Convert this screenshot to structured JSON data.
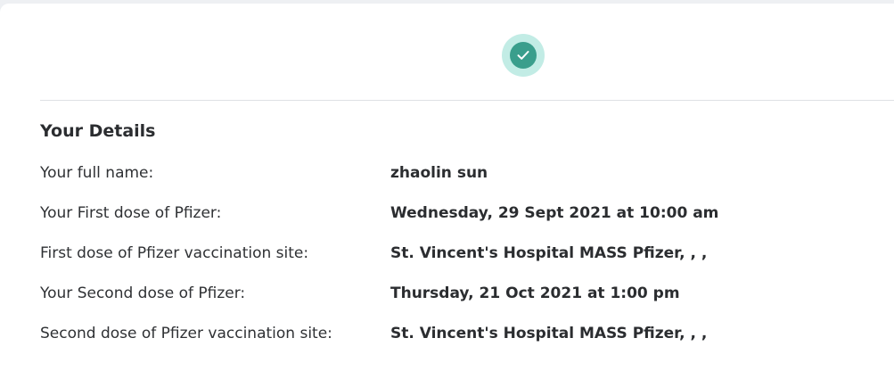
{
  "colors": {
    "accent": "#3a9e8c",
    "accent_light": "#c2ece5",
    "text": "#2b2d30"
  },
  "header": {
    "status_icon": "check-circle-icon"
  },
  "details": {
    "title": "Your Details",
    "rows": [
      {
        "label": "Your full name:",
        "value": "zhaolin sun"
      },
      {
        "label": "Your First dose of Pfizer:",
        "value": "Wednesday, 29 Sept 2021 at 10:00 am"
      },
      {
        "label": "First dose of Pfizer vaccination site:",
        "value": "St. Vincent's Hospital MASS Pfizer, , ,"
      },
      {
        "label": "Your Second dose of Pfizer:",
        "value": "Thursday, 21 Oct 2021 at 1:00 pm"
      },
      {
        "label": "Second dose of Pfizer vaccination site:",
        "value": "St. Vincent's Hospital MASS Pfizer, , ,"
      }
    ]
  }
}
